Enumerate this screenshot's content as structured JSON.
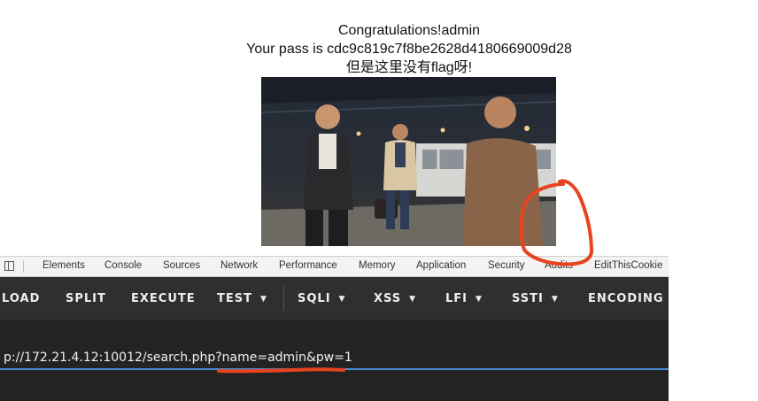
{
  "message": {
    "line1": "Congratulations!admin",
    "line2": "Your pass is cdc9c819c7f8be2628d4180669009d28",
    "line3": "但是这里没有flag呀!"
  },
  "devtools": {
    "tabs": [
      "Elements",
      "Console",
      "Sources",
      "Network",
      "Performance",
      "Memory",
      "Application",
      "Security",
      "Audits",
      "EditThisCookie"
    ]
  },
  "hackbar": {
    "buttons": [
      "LOAD",
      "SPLIT",
      "EXECUTE",
      "TEST",
      "SQLI",
      "XSS",
      "LFI",
      "SSTI",
      "ENCODING"
    ],
    "dropdowns": [
      "TEST",
      "SQLI",
      "XSS",
      "LFI",
      "SSTI"
    ],
    "url": "p://172.21.4.12:10012/search.php?name=admin&pw=1"
  },
  "colors": {
    "annotation": "#e8431f",
    "toolbar": "#2f2f2f",
    "url_underline": "#4a8fd6"
  }
}
